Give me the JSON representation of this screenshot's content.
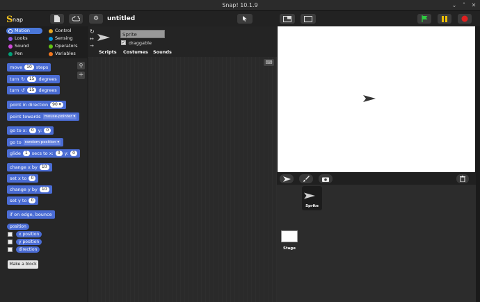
{
  "window": {
    "title": "Snap! 10.1.9"
  },
  "toolbar": {
    "project_title": "untitled"
  },
  "categories": [
    {
      "label": "Motion",
      "color": "#4a6cd4"
    },
    {
      "label": "Control",
      "color": "#e6a822"
    },
    {
      "label": "Looks",
      "color": "#8f56e3"
    },
    {
      "label": "Sensing",
      "color": "#0494dc"
    },
    {
      "label": "Sound",
      "color": "#cf4ad9"
    },
    {
      "label": "Operators",
      "color": "#62c213"
    },
    {
      "label": "Pen",
      "color": "#00a178"
    },
    {
      "label": "Variables",
      "color": "#f3761d"
    }
  ],
  "blocks": {
    "move": {
      "a": "move",
      "v": "10",
      "b": "steps"
    },
    "turn_cw": {
      "a": "turn",
      "v": "15",
      "b": "degrees"
    },
    "turn_ccw": {
      "a": "turn",
      "v": "15",
      "b": "degrees"
    },
    "point_dir": {
      "a": "point in direction",
      "v": "90"
    },
    "point_towards": {
      "a": "point towards",
      "v": "mouse-pointer"
    },
    "goto_xy": {
      "a": "go to x:",
      "x": "0",
      "b": "y:",
      "y": "0"
    },
    "goto": {
      "a": "go to",
      "v": "random position"
    },
    "glide": {
      "a": "glide",
      "v": "1",
      "b": "secs to x:",
      "x": "0",
      "c": "y:",
      "y": "0"
    },
    "change_x": {
      "a": "change x by",
      "v": "10"
    },
    "set_x": {
      "a": "set x to",
      "v": "0"
    },
    "change_y": {
      "a": "change y by",
      "v": "10"
    },
    "set_y": {
      "a": "set y to",
      "v": "0"
    },
    "bounce": {
      "a": "if on edge, bounce"
    },
    "position": "position",
    "x_position": "x position",
    "y_position": "y position",
    "direction": "direction"
  },
  "palette": {
    "make_block": "Make a block"
  },
  "sprite": {
    "name": "Sprite",
    "draggable_label": "draggable",
    "draggable": true
  },
  "tabs": [
    "Scripts",
    "Costumes",
    "Sounds"
  ],
  "corral": {
    "sprite_label": "Sprite",
    "stage_label": "Stage"
  },
  "colors": {
    "motion": "#4a6cd4",
    "green_flag": "#2ecc40",
    "pause": "#f0c000",
    "stop": "#e02020"
  }
}
